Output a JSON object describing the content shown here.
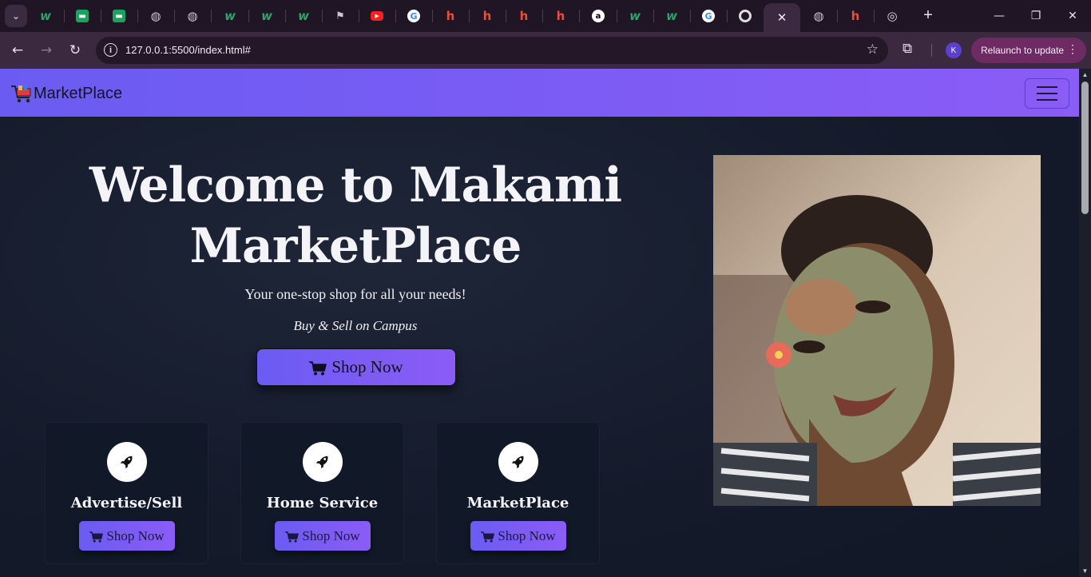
{
  "browser": {
    "tabs": [
      {
        "icon": "waveapps-icon",
        "glyph": "w",
        "cls": "w"
      },
      {
        "icon": "green-square-icon",
        "glyph": "▬",
        "cls": "sq"
      },
      {
        "icon": "green-square-icon",
        "glyph": "▬",
        "cls": "sq"
      },
      {
        "icon": "globe-icon",
        "glyph": "◍",
        "cls": "globe"
      },
      {
        "icon": "globe-icon",
        "glyph": "◍",
        "cls": "globe"
      },
      {
        "icon": "waveapps-icon",
        "glyph": "w",
        "cls": "w"
      },
      {
        "icon": "waveapps-icon",
        "glyph": "w",
        "cls": "w"
      },
      {
        "icon": "waveapps-icon",
        "glyph": "w",
        "cls": "w"
      },
      {
        "icon": "flag-icon",
        "glyph": "⚑",
        "cls": "flag"
      },
      {
        "icon": "youtube-icon",
        "glyph": "▶",
        "cls": "yt"
      },
      {
        "icon": "google-icon",
        "glyph": "G",
        "cls": "g"
      },
      {
        "icon": "h-logo-icon",
        "glyph": "h",
        "cls": "h"
      },
      {
        "icon": "h-logo-icon",
        "glyph": "h",
        "cls": "h"
      },
      {
        "icon": "h-logo-icon",
        "glyph": "h",
        "cls": "h"
      },
      {
        "icon": "h-logo-icon",
        "glyph": "h",
        "cls": "h"
      },
      {
        "icon": "amazon-icon",
        "glyph": "a",
        "cls": "amz"
      },
      {
        "icon": "waveapps-icon",
        "glyph": "w",
        "cls": "w"
      },
      {
        "icon": "waveapps-icon",
        "glyph": "w",
        "cls": "w"
      },
      {
        "icon": "google-icon",
        "glyph": "G",
        "cls": "g"
      },
      {
        "icon": "ring-icon",
        "glyph": "",
        "cls": "ring"
      },
      {
        "icon": "close-icon",
        "glyph": "✕",
        "cls": "active"
      },
      {
        "icon": "globe-icon",
        "glyph": "◍",
        "cls": "globe"
      },
      {
        "icon": "h-logo-icon",
        "glyph": "h",
        "cls": "h"
      },
      {
        "icon": "chrome-icon",
        "glyph": "◎",
        "cls": "chrome"
      }
    ],
    "new_tab": "+",
    "url": "127.0.0.1:5500/index.html#",
    "profile_initial": "K",
    "relaunch_label": "Relaunch to update",
    "colors": {
      "tabstrip": "#1f1524",
      "toolbar": "#3b2a3f",
      "relaunch": "#6e2a62"
    }
  },
  "navbar": {
    "brand": "MarketPlace",
    "colors": {
      "gradient_start": "#6a5cf2",
      "gradient_end": "#8b5cf6"
    }
  },
  "hero": {
    "title_line1": "Welcome to Makami",
    "title_line2": "MarketPlace",
    "subtitle": "Your one-stop shop for all your needs!",
    "tagline": "Buy & Sell on Campus",
    "cta_label": "Shop Now",
    "cta_icon": "cart-icon"
  },
  "cards": [
    {
      "title": "Advertise/Sell",
      "button": "Shop Now",
      "icon": "rocket-icon"
    },
    {
      "title": "Home Service",
      "button": "Shop Now",
      "icon": "rocket-icon"
    },
    {
      "title": "MarketPlace",
      "button": "Shop Now",
      "icon": "rocket-icon"
    }
  ],
  "photo": {
    "icon": "portrait-photo"
  }
}
